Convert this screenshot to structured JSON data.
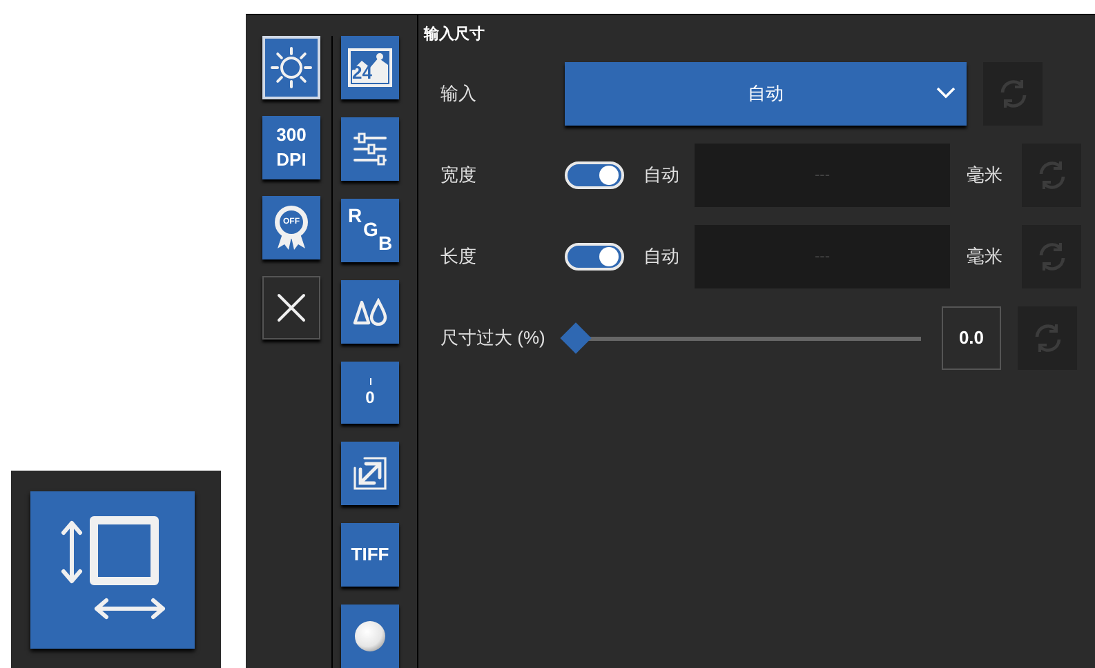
{
  "toolbar_left": [
    {
      "kind": "brightness",
      "selected": true
    },
    {
      "kind": "dpi",
      "lines": [
        "300",
        "DPI"
      ],
      "selected": false
    },
    {
      "kind": "badge",
      "label": "OFF",
      "selected": false
    },
    {
      "kind": "close",
      "selected": false
    }
  ],
  "toolbar_right": [
    {
      "kind": "picture",
      "label": "24"
    },
    {
      "kind": "sliders"
    },
    {
      "kind": "rgb",
      "letters": [
        "R",
        "G",
        "B"
      ]
    },
    {
      "kind": "drops"
    },
    {
      "kind": "zero",
      "label": "0"
    },
    {
      "kind": "resize"
    },
    {
      "kind": "text",
      "label": "TIFF"
    },
    {
      "kind": "ball"
    }
  ],
  "section": {
    "title": "输入尺寸"
  },
  "rows": [
    {
      "kind": "dropdown",
      "label": "输入",
      "value": "自动"
    },
    {
      "kind": "auto_field",
      "label": "宽度",
      "on": true,
      "toggle_label": "自动",
      "placeholder": "---",
      "unit": "毫米"
    },
    {
      "kind": "auto_field",
      "label": "长度",
      "on": true,
      "toggle_label": "自动",
      "placeholder": "---",
      "unit": "毫米"
    },
    {
      "kind": "slider",
      "label": "尺寸过大 (%)",
      "level": 0,
      "value": "0.0"
    }
  ]
}
